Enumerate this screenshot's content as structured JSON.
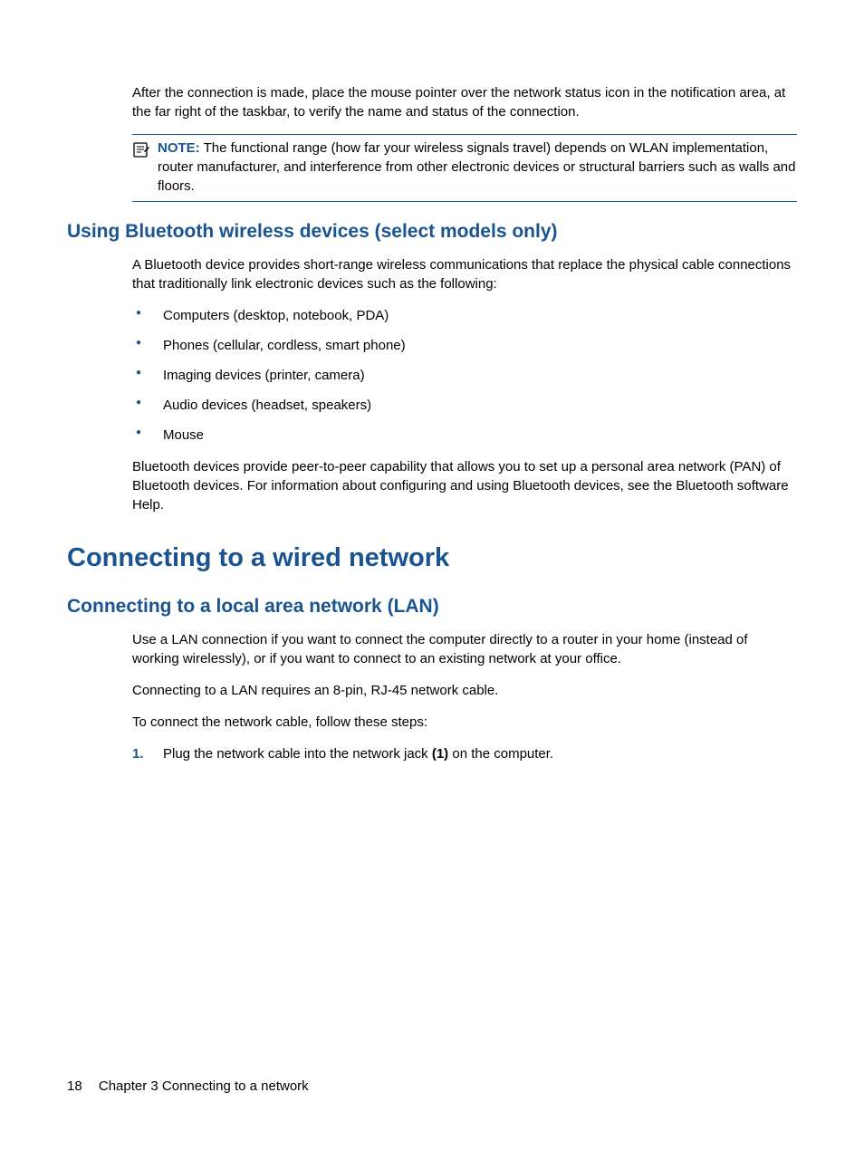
{
  "intro_para": "After the connection is made, place the mouse pointer over the network status icon in the notification area, at the far right of the taskbar, to verify the name and status of the connection.",
  "note": {
    "label": "NOTE:",
    "text": "The functional range (how far your wireless signals travel) depends on WLAN implementation, router manufacturer, and interference from other electronic devices or structural barriers such as walls and floors."
  },
  "bluetooth": {
    "heading": "Using Bluetooth wireless devices (select models only)",
    "para1": "A Bluetooth device provides short-range wireless communications that replace the physical cable connections that traditionally link electronic devices such as the following:",
    "items": [
      "Computers (desktop, notebook, PDA)",
      "Phones (cellular, cordless, smart phone)",
      "Imaging devices (printer, camera)",
      "Audio devices (headset, speakers)",
      "Mouse"
    ],
    "para2": "Bluetooth devices provide peer-to-peer capability that allows you to set up a personal area network (PAN) of Bluetooth devices. For information about configuring and using Bluetooth devices, see the Bluetooth software Help."
  },
  "wired": {
    "heading": "Connecting to a wired network",
    "lan": {
      "heading": "Connecting to a local area network (LAN)",
      "para1": "Use a LAN connection if you want to connect the computer directly to a router in your home (instead of working wirelessly), or if you want to connect to an existing network at your office.",
      "para2": "Connecting to a LAN requires an 8-pin, RJ-45 network cable.",
      "para3": "To connect the network cable, follow these steps:",
      "step1_num": "1.",
      "step1_pre": "Plug the network cable into the network jack ",
      "step1_bold": "(1)",
      "step1_post": " on the computer."
    }
  },
  "footer": {
    "page": "18",
    "chapter": "Chapter 3   Connecting to a network"
  }
}
